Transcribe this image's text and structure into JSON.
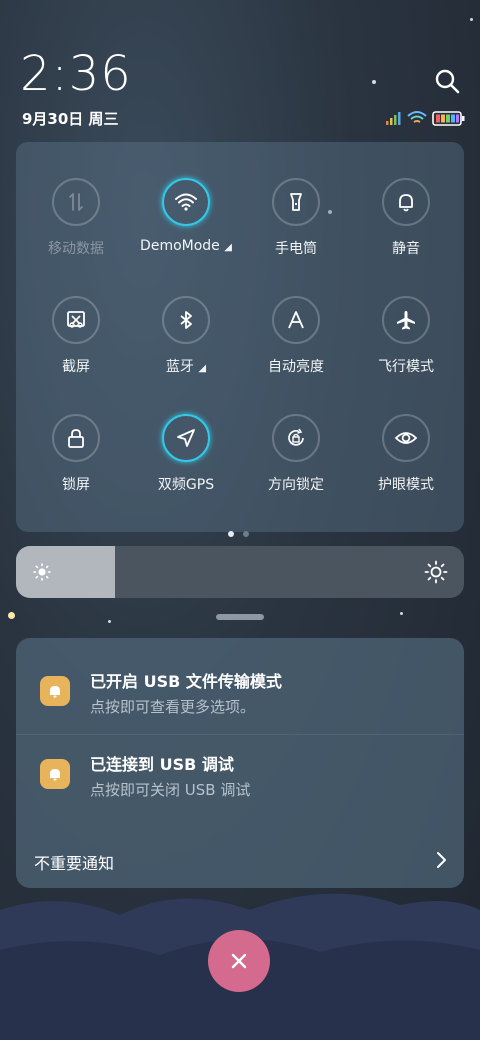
{
  "status_bar": {
    "time": "2:36",
    "date": "9月30日 周三"
  },
  "quick_tiles": [
    {
      "label": "移动数据",
      "icon": "mobile-data-icon",
      "active": false,
      "disabled": true
    },
    {
      "label": "DemoMode",
      "icon": "wifi-icon",
      "active": true,
      "disabled": false,
      "expandable": true
    },
    {
      "label": "手电筒",
      "icon": "flashlight-icon",
      "active": false,
      "disabled": false
    },
    {
      "label": "静音",
      "icon": "bell-icon",
      "active": false,
      "disabled": false
    },
    {
      "label": "截屏",
      "icon": "screenshot-icon",
      "active": false,
      "disabled": false
    },
    {
      "label": "蓝牙",
      "icon": "bluetooth-icon",
      "active": false,
      "disabled": false,
      "expandable": true
    },
    {
      "label": "自动亮度",
      "icon": "auto-brightness-icon",
      "active": false,
      "disabled": false
    },
    {
      "label": "飞行模式",
      "icon": "airplane-icon",
      "active": false,
      "disabled": false
    },
    {
      "label": "锁屏",
      "icon": "lock-icon",
      "active": false,
      "disabled": false
    },
    {
      "label": "双频GPS",
      "icon": "location-arrow-icon",
      "active": true,
      "disabled": false
    },
    {
      "label": "方向锁定",
      "icon": "rotation-lock-icon",
      "active": false,
      "disabled": false
    },
    {
      "label": "护眼模式",
      "icon": "eye-icon",
      "active": false,
      "disabled": false
    }
  ],
  "pager": {
    "pages": 2,
    "current": 1
  },
  "brightness": {
    "level": 0.22
  },
  "notifications": [
    {
      "title": "已开启 USB 文件传输模式",
      "subtitle": "点按即可查看更多选项。",
      "icon": "bell-icon"
    },
    {
      "title": "已连接到 USB 调试",
      "subtitle": "点按即可关闭 USB 调试",
      "icon": "bell-icon"
    }
  ],
  "unimportant_label": "不重要通知",
  "colors": {
    "accent": "#33c8e8",
    "notif_icon": "#e8b45b",
    "close_button": "#d46a8e"
  }
}
